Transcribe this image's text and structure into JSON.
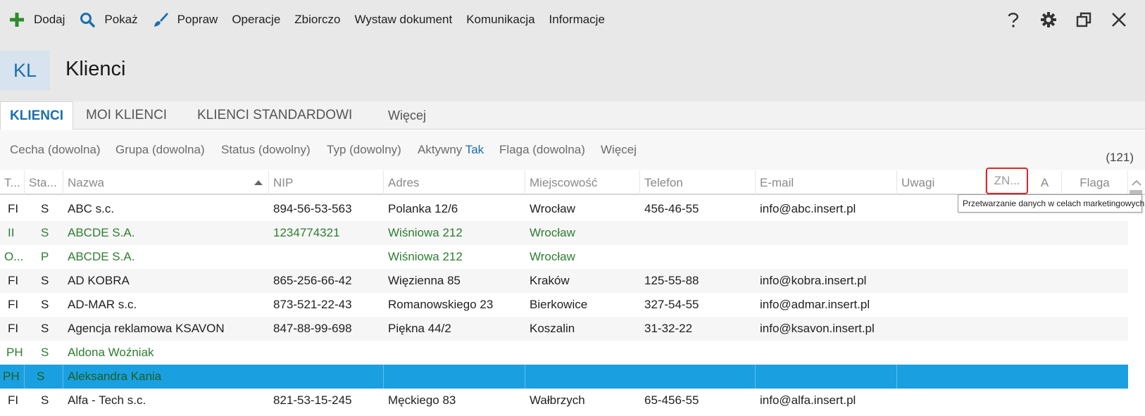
{
  "toolbar": {
    "items": [
      {
        "label": "Dodaj",
        "icon": "plus-icon"
      },
      {
        "label": "Pokaż",
        "icon": "search-icon"
      },
      {
        "label": "Popraw",
        "icon": "brush-icon"
      },
      {
        "label": "Operacje"
      },
      {
        "label": "Zbiorczo"
      },
      {
        "label": "Wystaw dokument"
      },
      {
        "label": "Komunikacja"
      },
      {
        "label": "Informacje"
      }
    ],
    "right": [
      "help-icon",
      "gear-icon",
      "restore-window-icon",
      "close-icon"
    ]
  },
  "header": {
    "badge": "KL",
    "title": "Klienci"
  },
  "tabs": [
    {
      "label": "KLIENCI",
      "active": true
    },
    {
      "label": "MOI KLIENCI"
    },
    {
      "label": "KLIENCI STANDARDOWI"
    },
    {
      "label": "Więcej"
    }
  ],
  "filters": [
    {
      "label": "Cecha (dowolna)"
    },
    {
      "label": "Grupa (dowolna)"
    },
    {
      "label": "Status (dowolny)"
    },
    {
      "label": "Typ (dowolny)"
    },
    {
      "label": "Aktywny",
      "value": "Tak"
    },
    {
      "label": "Flaga (dowolna)"
    },
    {
      "label": "Więcej"
    }
  ],
  "count": "(121)",
  "columns": [
    "T...",
    "Sta...",
    "Nazwa",
    "NIP",
    "Adres",
    "Miejscowość",
    "Telefon",
    "E-mail",
    "Uwagi",
    "ZN...",
    "A",
    "Flaga"
  ],
  "tooltip": "Przetwarzanie danych w celach marketingowych",
  "rows": [
    [
      "FI",
      "S",
      "ABC s.c.",
      "894-56-53-563",
      "Polanka  12/6",
      "Wrocław",
      "456-46-55",
      "info@abc.insert.pl"
    ],
    [
      "II",
      "S",
      "ABCDE S.A.",
      "1234774321",
      "Wiśniowa 212",
      "Wrocław",
      "",
      ""
    ],
    [
      "O...",
      "P",
      "ABCDE S.A.",
      "",
      "Wiśniowa 212",
      "Wrocław",
      "",
      ""
    ],
    [
      "FI",
      "S",
      "AD KOBRA",
      "865-256-66-42",
      "Więzienna  85",
      "Kraków",
      "125-55-88",
      "info@kobra.insert.pl"
    ],
    [
      "FI",
      "S",
      "AD-MAR s.c.",
      "873-521-22-43",
      "Romanowskiego 23",
      "Bierkowice",
      "327-54-55",
      "info@admar.insert.pl"
    ],
    [
      "FI",
      "S",
      "Agencja reklamowa KSAVON",
      "847-88-99-698",
      "Piękna  44/2",
      "Koszalin",
      "31-32-22",
      "info@ksavon.insert.pl"
    ],
    [
      "PH",
      "S",
      "Aldona Woźniak",
      "",
      "",
      "",
      "",
      ""
    ],
    [
      "PH",
      "S",
      "Aleksandra Kania",
      "",
      "",
      "",
      "",
      ""
    ],
    [
      "FI",
      "S",
      "Alfa - Tech s.c.",
      "821-53-15-245",
      "Męckiego  83",
      "Wałbrzych",
      "65-456-55",
      "info@alfa.insert.pl"
    ]
  ],
  "colors": {
    "accent": "#1a6fb0",
    "green": "#2e7d32",
    "selected": "#1aa0e0",
    "highlight": "#e0252a"
  }
}
